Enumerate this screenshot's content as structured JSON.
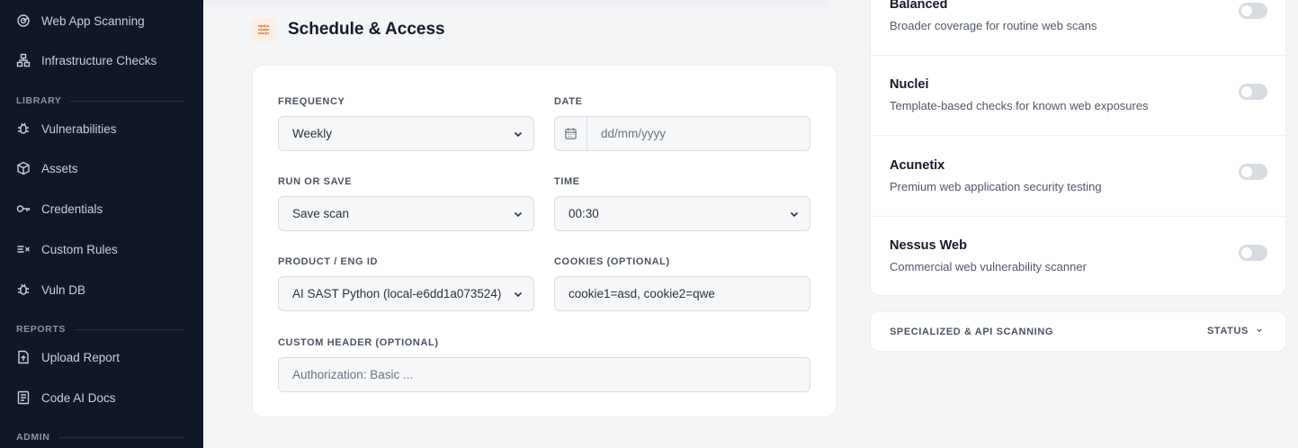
{
  "sidebar": {
    "items_top": [
      {
        "label": "Web App Scanning",
        "icon": "radar-icon"
      },
      {
        "label": "Infrastructure Checks",
        "icon": "network-icon"
      }
    ],
    "library_label": "LIBRARY",
    "library_items": [
      {
        "label": "Vulnerabilities",
        "icon": "bug-icon"
      },
      {
        "label": "Assets",
        "icon": "cube-icon"
      },
      {
        "label": "Credentials",
        "icon": "key-icon"
      },
      {
        "label": "Custom Rules",
        "icon": "rules-icon"
      },
      {
        "label": "Vuln DB",
        "icon": "bug-icon"
      }
    ],
    "reports_label": "REPORTS",
    "reports_items": [
      {
        "label": "Upload Report",
        "icon": "file-upload-icon"
      },
      {
        "label": "Code AI Docs",
        "icon": "document-icon"
      }
    ],
    "admin_label": "ADMIN"
  },
  "schedule": {
    "title": "Schedule & Access",
    "frequency_label": "FREQUENCY",
    "frequency_value": "Weekly",
    "date_label": "DATE",
    "date_placeholder": "dd/mm/yyyy",
    "run_label": "RUN OR SAVE",
    "run_value": "Save scan",
    "time_label": "TIME",
    "time_value": "00:30",
    "product_label": "PRODUCT / ENG ID",
    "product_value": "AI SAST Python (local-e6dd1a073524)",
    "cookies_label": "COOKIES (OPTIONAL)",
    "cookies_value": "cookie1=asd, cookie2=qwe",
    "header_label": "CUSTOM HEADER (OPTIONAL)",
    "header_placeholder": "Authorization: Basic ..."
  },
  "scanners": [
    {
      "name": "Balanced",
      "desc": "Broader coverage for routine web scans",
      "enabled": false
    },
    {
      "name": "Nuclei",
      "desc": "Template-based checks for known web exposures",
      "enabled": false
    },
    {
      "name": "Acunetix",
      "desc": "Premium web application security testing",
      "enabled": false
    },
    {
      "name": "Nessus Web",
      "desc": "Commercial web vulnerability scanner",
      "enabled": false
    }
  ],
  "api_section": {
    "title": "SPECIALIZED & API SCANNING",
    "status_label": "STATUS"
  },
  "colors": {
    "sidebar_bg": "#101727",
    "accent_orange": "#e8782e"
  }
}
